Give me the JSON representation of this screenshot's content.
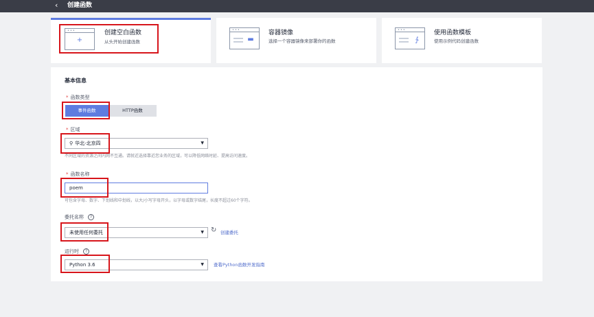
{
  "header": {
    "back_icon": "chevron-left-icon",
    "title": "创建函数"
  },
  "creation_options": [
    {
      "title": "创建空白函数",
      "desc": "从头开始创建函数",
      "selected": true,
      "icon": "blank-function-icon",
      "icon_glyph": "+"
    },
    {
      "title": "容器镜像",
      "desc": "选择一个容器镜像来部署你的函数",
      "selected": false,
      "icon": "container-image-icon",
      "icon_glyph": "▬"
    },
    {
      "title": "使用函数模板",
      "desc": "使用示例代码创建函数",
      "selected": false,
      "icon": "function-template-icon",
      "icon_glyph": "∱"
    }
  ],
  "basic_info": {
    "section_title": "基本信息",
    "function_type": {
      "label": "函数类型",
      "options": [
        "事件函数",
        "HTTP函数"
      ],
      "selected": "事件函数"
    },
    "region": {
      "label": "区域",
      "value": "华北-北京四",
      "hint": "不同区域的资源之间内网不互通。请就近选择靠近您业务的区域，可以降低网络时延、提高访问速度。"
    },
    "function_name": {
      "label": "函数名称",
      "value": "poem",
      "hint": "可包含字母、数字、下划线和中划线，以大/小写字母开头，以字母或数字结尾，长度不超过60个字符。"
    },
    "agency": {
      "label": "委托名称",
      "value": "未使用任何委托",
      "create_link": "创建委托"
    },
    "runtime": {
      "label": "运行时",
      "value": "Python 3.6",
      "guide_link": "查看Python函数开发指南"
    }
  },
  "colors": {
    "accent": "#5e7ce0",
    "highlight_box": "#d7141a",
    "required_star": "#e54545",
    "topbar": "#3a3d47"
  }
}
